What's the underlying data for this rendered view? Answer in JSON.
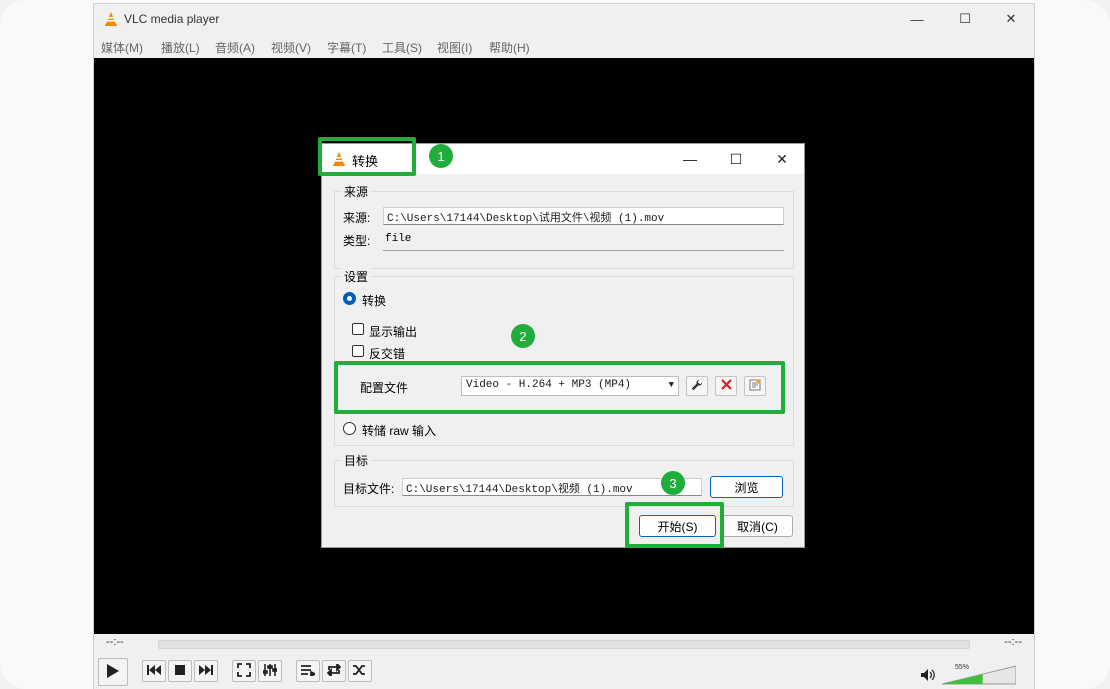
{
  "window": {
    "title": "VLC media player",
    "minimize": "—",
    "maximize": "☐",
    "close": "✕"
  },
  "menu": [
    "媒体(M)",
    "播放(L)",
    "音频(A)",
    "视频(V)",
    "字幕(T)",
    "工具(S)",
    "视图(I)",
    "帮助(H)"
  ],
  "player": {
    "time_elapsed": "--:--",
    "time_total": "--:--",
    "volume": "55%",
    "volume_level": 0.55
  },
  "dialog": {
    "title": "转换",
    "source_group": "来源",
    "source_label": "来源:",
    "source_value": "C:\\Users\\17144\\Desktop\\试用文件\\视频 (1).mov",
    "type_label": "类型:",
    "type_value": "file",
    "settings_group": "设置",
    "convert_radio": "转换",
    "show_output": "显示输出",
    "deinterlace": "反交错",
    "profile_label": "配置文件",
    "profile_value": "Video - H.264 + MP3 (MP4)",
    "dump_raw": "转储 raw 输入",
    "dest_group": "目标",
    "dest_label": "目标文件:",
    "dest_value": "C:\\Users\\17144\\Desktop\\视频 (1).mov",
    "browse": "浏览",
    "start": "开始(S)",
    "cancel": "取消(C)"
  },
  "annotations": {
    "step1": "1",
    "step2": "2",
    "step3": "3",
    "color": "#1fad3b"
  }
}
